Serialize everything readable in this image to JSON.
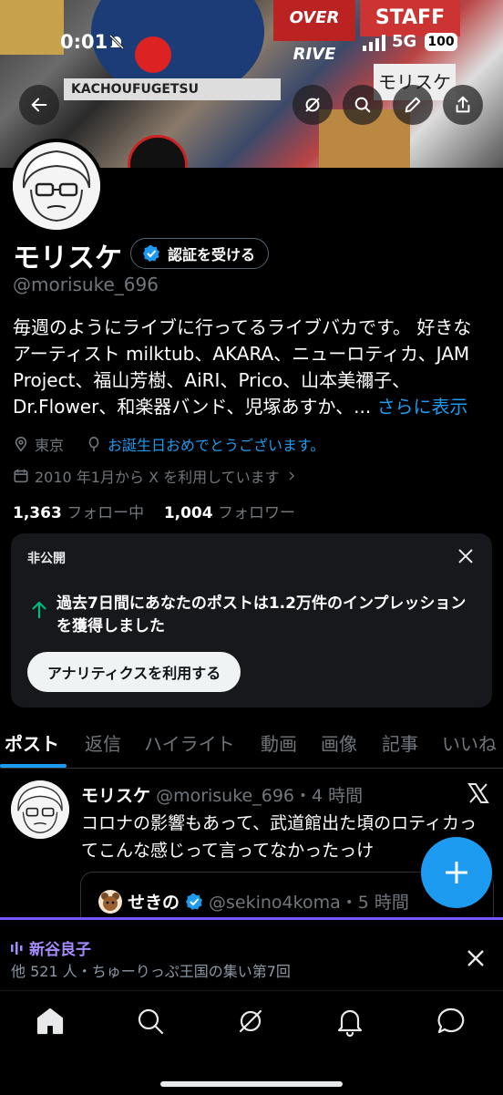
{
  "status_bar": {
    "time": "0:01",
    "network": "5G",
    "battery": "100"
  },
  "banner": {
    "stickers": [
      "OVER RIVE",
      "STAFF",
      "KACHOUFUGETSU",
      "モリスケ"
    ]
  },
  "top_actions": {
    "back_icon": "arrow-left-icon",
    "grok_icon": "grok-icon",
    "search_icon": "search-icon",
    "edit_icon": "pencil-icon",
    "share_icon": "share-icon"
  },
  "profile": {
    "name": "モリスケ",
    "verify_label": "認証を受ける",
    "handle": "@morisuke_696",
    "bio_line1": "毎週のようにライブに行ってるライブバカです。 好きな",
    "bio_line2": "アーティスト milktub、AKARA、ニューロティカ、JAM",
    "bio_line3": "Project、福山芳樹、AiRI、Prico、山本美禰子、",
    "bio_line4": "Dr.Flower、和楽器バンド、児塚あすか、...",
    "bio_more": "さらに表示",
    "location": "東京",
    "birthday": "お誕生日おめでとうございます。",
    "joined": "2010 年1月から X を利用しています",
    "following_count": "1,363",
    "following_label": "フォロー中",
    "followers_count": "1,004",
    "followers_label": "フォロワー"
  },
  "analytics_card": {
    "label": "非公開",
    "text": "過去7日間にあなたのポストは1.2万件のインプレッションを獲得しました",
    "button": "アナリティクスを利用する"
  },
  "tabs": [
    "ポスト",
    "返信",
    "ハイライト",
    "動画",
    "画像",
    "記事",
    "いいね"
  ],
  "tweet": {
    "name": "モリスケ",
    "handle_time": "@morisuke_696・4 時間",
    "body": "コロナの影響もあって、武道館出た頃のロティカってこんな感じって言ってなかったっけ",
    "quote_name": "せきの",
    "quote_handle_time": "@sekino4koma・5 時間"
  },
  "space": {
    "title": "新谷良子",
    "subtitle": "他 521 人・ちゅーりっぷ王国の集い第7回"
  },
  "colors": {
    "accent": "#1d9bf0",
    "space": "#7856ff",
    "card": "#16181c"
  }
}
